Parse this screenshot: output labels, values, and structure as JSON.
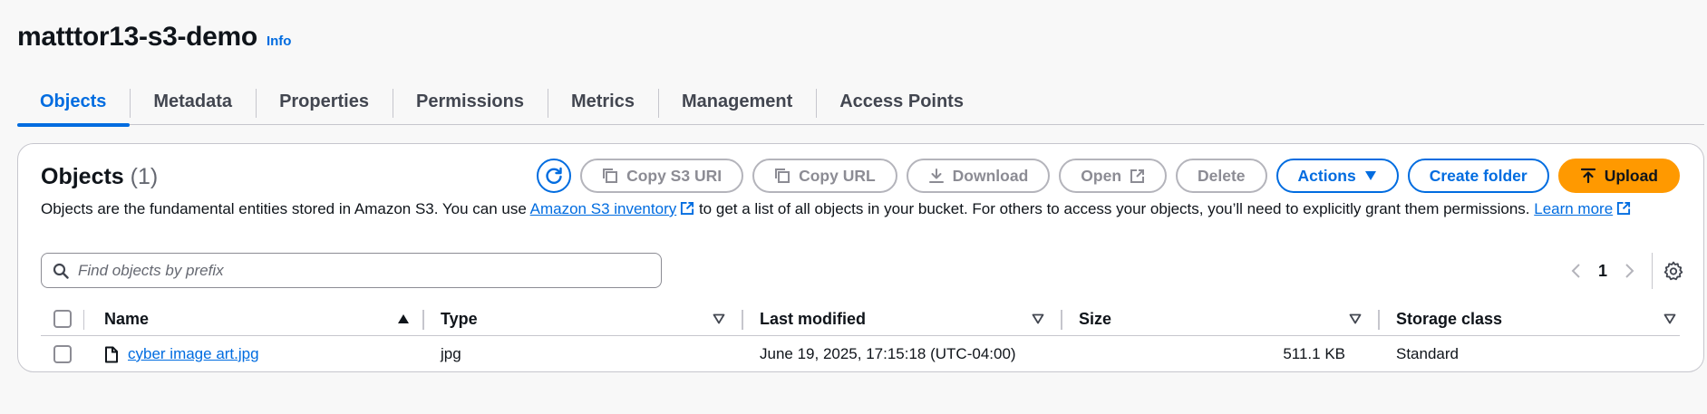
{
  "header": {
    "bucket_name": "matttor13-s3-demo",
    "info_label": "Info"
  },
  "tabs": [
    {
      "label": "Objects",
      "active": true
    },
    {
      "label": "Metadata"
    },
    {
      "label": "Properties"
    },
    {
      "label": "Permissions"
    },
    {
      "label": "Metrics"
    },
    {
      "label": "Management"
    },
    {
      "label": "Access Points"
    }
  ],
  "objects": {
    "title": "Objects",
    "count": "(1)",
    "description_pre": "Objects are the fundamental entities stored in Amazon S3. You can use ",
    "inventory_link": "Amazon S3 inventory",
    "description_post": " to get a list of all objects in your bucket. For others to access your objects, you’ll need to explicitly grant them permissions. ",
    "learn_more": "Learn more"
  },
  "toolbar": {
    "copy_s3_uri": "Copy S3 URI",
    "copy_url": "Copy URL",
    "download": "Download",
    "open": "Open",
    "delete": "Delete",
    "actions": "Actions",
    "create_folder": "Create folder",
    "upload": "Upload"
  },
  "search": {
    "placeholder": "Find objects by prefix"
  },
  "pagination": {
    "page": "1"
  },
  "table": {
    "columns": [
      "Name",
      "Type",
      "Last modified",
      "Size",
      "Storage class"
    ],
    "rows": [
      {
        "name": "cyber image art.jpg",
        "type": "jpg",
        "last_modified": "June 19, 2025, 17:15:18 (UTC-04:00)",
        "size": "511.1 KB",
        "storage_class": "Standard"
      }
    ]
  },
  "colors": {
    "accent": "#006ce0",
    "upload": "#ff9900",
    "disabled": "#8c8c94"
  }
}
